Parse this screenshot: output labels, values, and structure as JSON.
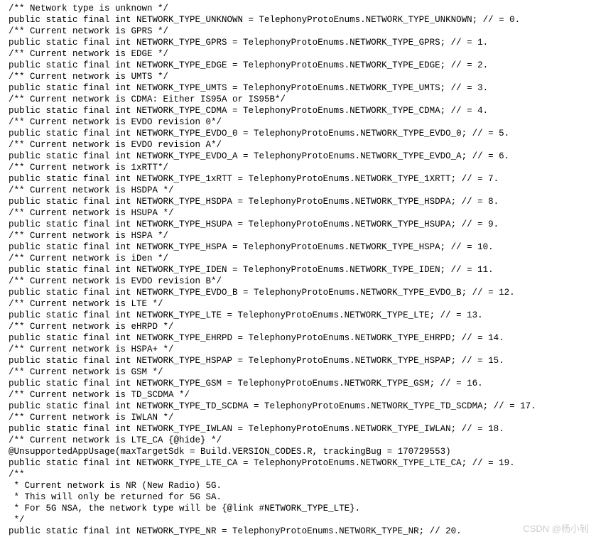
{
  "lines": [
    "/** Network type is unknown */",
    "public static final int NETWORK_TYPE_UNKNOWN = TelephonyProtoEnums.NETWORK_TYPE_UNKNOWN; // = 0.",
    "/** Current network is GPRS */",
    "public static final int NETWORK_TYPE_GPRS = TelephonyProtoEnums.NETWORK_TYPE_GPRS; // = 1.",
    "/** Current network is EDGE */",
    "public static final int NETWORK_TYPE_EDGE = TelephonyProtoEnums.NETWORK_TYPE_EDGE; // = 2.",
    "/** Current network is UMTS */",
    "public static final int NETWORK_TYPE_UMTS = TelephonyProtoEnums.NETWORK_TYPE_UMTS; // = 3.",
    "/** Current network is CDMA: Either IS95A or IS95B*/",
    "public static final int NETWORK_TYPE_CDMA = TelephonyProtoEnums.NETWORK_TYPE_CDMA; // = 4.",
    "/** Current network is EVDO revision 0*/",
    "public static final int NETWORK_TYPE_EVDO_0 = TelephonyProtoEnums.NETWORK_TYPE_EVDO_0; // = 5.",
    "/** Current network is EVDO revision A*/",
    "public static final int NETWORK_TYPE_EVDO_A = TelephonyProtoEnums.NETWORK_TYPE_EVDO_A; // = 6.",
    "/** Current network is 1xRTT*/",
    "public static final int NETWORK_TYPE_1xRTT = TelephonyProtoEnums.NETWORK_TYPE_1XRTT; // = 7.",
    "/** Current network is HSDPA */",
    "public static final int NETWORK_TYPE_HSDPA = TelephonyProtoEnums.NETWORK_TYPE_HSDPA; // = 8.",
    "/** Current network is HSUPA */",
    "public static final int NETWORK_TYPE_HSUPA = TelephonyProtoEnums.NETWORK_TYPE_HSUPA; // = 9.",
    "/** Current network is HSPA */",
    "public static final int NETWORK_TYPE_HSPA = TelephonyProtoEnums.NETWORK_TYPE_HSPA; // = 10.",
    "/** Current network is iDen */",
    "public static final int NETWORK_TYPE_IDEN = TelephonyProtoEnums.NETWORK_TYPE_IDEN; // = 11.",
    "/** Current network is EVDO revision B*/",
    "public static final int NETWORK_TYPE_EVDO_B = TelephonyProtoEnums.NETWORK_TYPE_EVDO_B; // = 12.",
    "/** Current network is LTE */",
    "public static final int NETWORK_TYPE_LTE = TelephonyProtoEnums.NETWORK_TYPE_LTE; // = 13.",
    "/** Current network is eHRPD */",
    "public static final int NETWORK_TYPE_EHRPD = TelephonyProtoEnums.NETWORK_TYPE_EHRPD; // = 14.",
    "/** Current network is HSPA+ */",
    "public static final int NETWORK_TYPE_HSPAP = TelephonyProtoEnums.NETWORK_TYPE_HSPAP; // = 15.",
    "/** Current network is GSM */",
    "public static final int NETWORK_TYPE_GSM = TelephonyProtoEnums.NETWORK_TYPE_GSM; // = 16.",
    "/** Current network is TD_SCDMA */",
    "public static final int NETWORK_TYPE_TD_SCDMA = TelephonyProtoEnums.NETWORK_TYPE_TD_SCDMA; // = 17.",
    "/** Current network is IWLAN */",
    "public static final int NETWORK_TYPE_IWLAN = TelephonyProtoEnums.NETWORK_TYPE_IWLAN; // = 18.",
    "/** Current network is LTE_CA {@hide} */",
    "@UnsupportedAppUsage(maxTargetSdk = Build.VERSION_CODES.R, trackingBug = 170729553)",
    "public static final int NETWORK_TYPE_LTE_CA = TelephonyProtoEnums.NETWORK_TYPE_LTE_CA; // = 19.",
    "/**",
    " * Current network is NR (New Radio) 5G.",
    " * This will only be returned for 5G SA.",
    " * For 5G NSA, the network type will be {@link #NETWORK_TYPE_LTE}.",
    " */",
    "public static final int NETWORK_TYPE_NR = TelephonyProtoEnums.NETWORK_TYPE_NR; // 20."
  ],
  "watermark": "CSDN @杨小钊"
}
